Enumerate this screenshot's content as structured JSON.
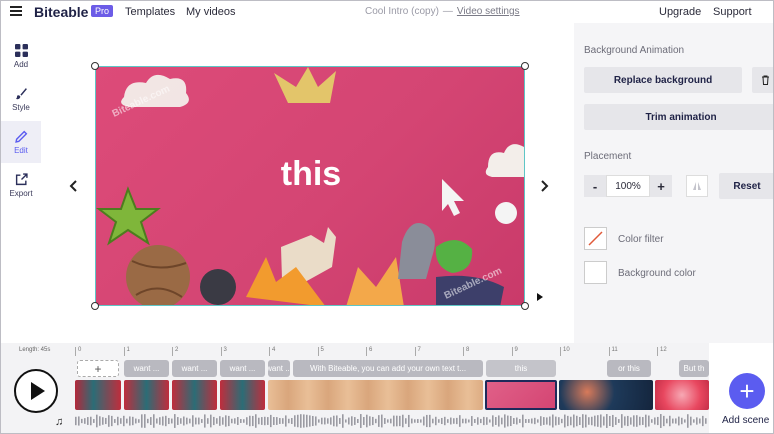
{
  "header": {
    "logo": "Biteable",
    "badge": "Pro",
    "nav": [
      "Templates",
      "My videos"
    ],
    "project_title": "Cool Intro (copy)",
    "separator": "—",
    "video_settings": "Video settings",
    "upgrade": "Upgrade",
    "support": "Support"
  },
  "sidebar": {
    "items": [
      {
        "label": "Add",
        "icon": "grid-icon"
      },
      {
        "label": "Style",
        "icon": "brush-icon"
      },
      {
        "label": "Edit",
        "icon": "pencil-icon"
      },
      {
        "label": "Export",
        "icon": "export-icon"
      }
    ]
  },
  "canvas": {
    "text": "this",
    "watermark": "Biteable.com"
  },
  "panel": {
    "bg_anim_label": "Background Animation",
    "replace_bg": "Replace background",
    "trim_anim": "Trim animation",
    "placement_label": "Placement",
    "zoom_minus": "-",
    "zoom_value": "100%",
    "zoom_plus": "+",
    "reset": "Reset",
    "color_filter": "Color filter",
    "background_color": "Background color"
  },
  "timeline": {
    "length": "Length: 45s",
    "ticks": [
      "0",
      "1",
      "2",
      "3",
      "4",
      "5",
      "6",
      "7",
      "8",
      "9",
      "10",
      "11",
      "12"
    ],
    "add_small": "+",
    "captions": [
      "want ...",
      "want ...",
      "want ...",
      "want ...",
      "With Biteable, you can add your own text t...",
      "this",
      "or this",
      "But th"
    ],
    "add_scene": "Add scene"
  },
  "colors": {
    "accent": "#5b5cf0",
    "canvas_bg": "#d44573",
    "brand_navy": "#1f2246"
  }
}
